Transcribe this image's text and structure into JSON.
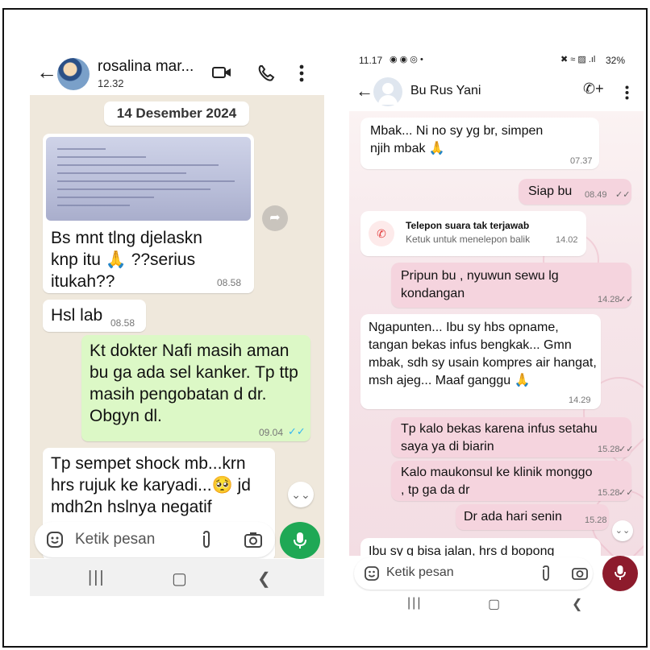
{
  "left_phone": {
    "contact_name": "rosalina mar...",
    "last_seen": "12.32",
    "date_chip": "14 Desember 2024",
    "messages": [
      {
        "dir": "in",
        "text": "Bs mnt tlng djelaskn knp itu 🙏 ??serius itukah??",
        "time": "08.58"
      },
      {
        "dir": "in",
        "text": "Hsl lab",
        "time": "08.58"
      },
      {
        "dir": "out",
        "text": "Kt dokter Nafi masih aman bu ga ada sel kanker. Tp ttp masih pengobatan d dr. Obgyn dl.",
        "time": "09.04"
      },
      {
        "dir": "in",
        "text": "Tp sempet shock mb...krn hrs rujuk ke karyadi...🥺 jd mdh2n hslnya negatif",
        "time": ""
      }
    ],
    "input_placeholder": "Ketik pesan",
    "icons": {
      "back": "back-arrow-icon",
      "video": "video-call-icon",
      "call": "phone-icon",
      "menu": "more-vert-icon",
      "emoji": "emoji-icon",
      "attach": "attach-icon",
      "camera": "camera-icon",
      "mic": "mic-icon"
    },
    "colors": {
      "chat_bg": "#efe8dc",
      "out_bubble": "#dcf8c6",
      "mic": "#1fa855"
    }
  },
  "right_phone": {
    "status_time": "11.17",
    "battery": "32%",
    "contact_name": "Bu Rus Yani",
    "messages": [
      {
        "dir": "in",
        "text": "Mbak... Ni no sy yg br, simpen njih mbak 🙏",
        "time": "07.37"
      },
      {
        "dir": "out",
        "text": "Siap bu",
        "time": "08.49"
      },
      {
        "dir": "call",
        "title": "Telepon suara tak terjawab",
        "subtitle": "Ketuk untuk menelepon balik",
        "time": "14.02"
      },
      {
        "dir": "out",
        "text": "Pripun bu , nyuwun sewu lg kondangan",
        "time": "14.28"
      },
      {
        "dir": "in",
        "text": "Ngapunten... Ibu sy hbs opname, tangan bekas infus bengkak... Gmn mbak, sdh sy usain kompres air hangat, msh ajeg... Maaf ganggu 🙏",
        "time": "14.29"
      },
      {
        "dir": "out",
        "text": "Tp kalo bekas karena infus setahu saya ya di biarin",
        "time": "15.28"
      },
      {
        "dir": "out",
        "text": "Kalo maukonsul ke klinik monggo , tp ga da dr",
        "time": "15.28"
      },
      {
        "dir": "out",
        "text": "Dr ada hari senin",
        "time": "15.28"
      },
      {
        "dir": "in",
        "text": "Ibu sy g bisa jalan, hrs d bopong",
        "time": ""
      }
    ],
    "input_placeholder": "Ketik pesan",
    "colors": {
      "out_bubble": "#f5d4de",
      "mic": "#8d1b2c"
    }
  }
}
